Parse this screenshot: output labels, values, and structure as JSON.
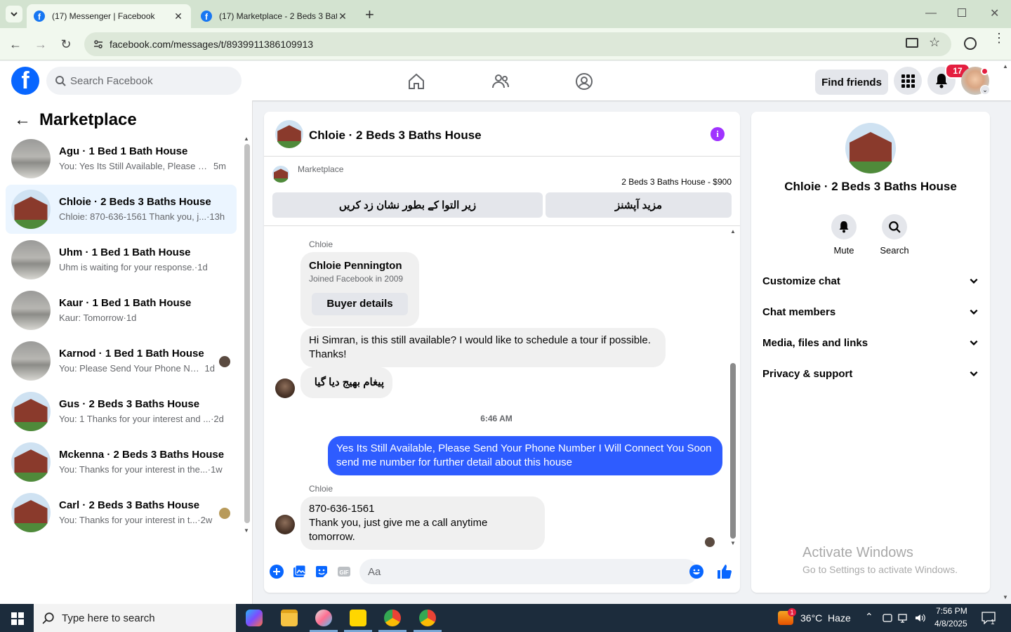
{
  "browser": {
    "tabs": [
      {
        "title": "(17) Messenger | Facebook",
        "active": true
      },
      {
        "title": "(17) Marketplace - 2 Beds 3 Bat",
        "active": false
      }
    ],
    "url": "facebook.com/messages/t/8939911386109913"
  },
  "fb_header": {
    "search_placeholder": "Search Facebook",
    "find_friends": "Find friends",
    "notification_count": "17"
  },
  "left_panel": {
    "title": "Marketplace",
    "conversations": [
      {
        "name": "Agu · 1 Bed 1 Bath House",
        "preview": "You: Yes Its Still Available, Please S...",
        "time": "5m",
        "avatar": "grey",
        "selected": false
      },
      {
        "name": "Chloie · 2 Beds 3 Baths House",
        "preview": "Chloie: 870-636-1561 Thank you, j...",
        "time": "·13h",
        "avatar": "house",
        "selected": true
      },
      {
        "name": "Uhm · 1 Bed 1 Bath House",
        "preview": "Uhm is waiting for your response.",
        "time": "·1d",
        "avatar": "grey",
        "selected": false
      },
      {
        "name": "Kaur · 1 Bed 1 Bath House",
        "preview": "Kaur: Tomorrow",
        "time": "·1d",
        "avatar": "grey",
        "selected": false
      },
      {
        "name": "Karnod · 1 Bed 1 Bath House",
        "preview": "You: Please Send Your Phone Nu...",
        "time": "1d",
        "avatar": "grey",
        "selected": false
      },
      {
        "name": "Gus · 2 Beds 3 Baths House",
        "preview": "You: 1 Thanks for your interest and ...",
        "time": "·2d",
        "avatar": "house",
        "selected": false
      },
      {
        "name": "Mckenna · 2 Beds 3 Baths House",
        "preview": "You: Thanks for your interest in the...",
        "time": "·1w",
        "avatar": "house",
        "selected": false
      },
      {
        "name": "Carl · 2 Beds 3 Baths House",
        "preview": "You: Thanks for your interest in t...",
        "time": "·2w",
        "avatar": "house",
        "selected": false
      }
    ]
  },
  "chat": {
    "title": "Chloie · 2 Beds 3 Baths House",
    "marketplace_label": "Marketplace",
    "listing_price": "2 Beds 3 Baths House - $900",
    "btn_mark_pending": "زیر التوا کے بطور نشان زد کریں",
    "btn_more_options": "مزید آپشنز",
    "sender_name": "Chloie",
    "card_name": "Chloie Pennington",
    "card_joined": "Joined Facebook in 2009",
    "card_button": "Buyer details",
    "msg1": "Hi Simran, is this still available? I would like to schedule a tour if possible. Thanks!",
    "msg2": "پیغام بھیج دیا گیا",
    "timestamp": "6:46 AM",
    "msg_me": "Yes Its Still Available, Please Send Your Phone Number I Will Connect You Soon send me number for further detail about this house",
    "sender_name2": "Chloie",
    "msg3_line1": "870-636-1561",
    "msg3_line2": "Thank you, just give me a call anytime tomorrow.",
    "composer_placeholder": "Aa"
  },
  "right_panel": {
    "name": "Chloie · 2 Beds 3 Baths House",
    "mute": "Mute",
    "search": "Search",
    "sections": [
      "Customize chat",
      "Chat members",
      "Media, files and links",
      "Privacy & support"
    ]
  },
  "watermark": {
    "line1": "Activate Windows",
    "line2": "Go to Settings to activate Windows."
  },
  "taskbar": {
    "search_placeholder": "Type here to search",
    "weather": "36°C  Haze",
    "time": "7:56 PM",
    "date": "4/8/2025",
    "notif_count": "1",
    "weather_badge": "1"
  }
}
